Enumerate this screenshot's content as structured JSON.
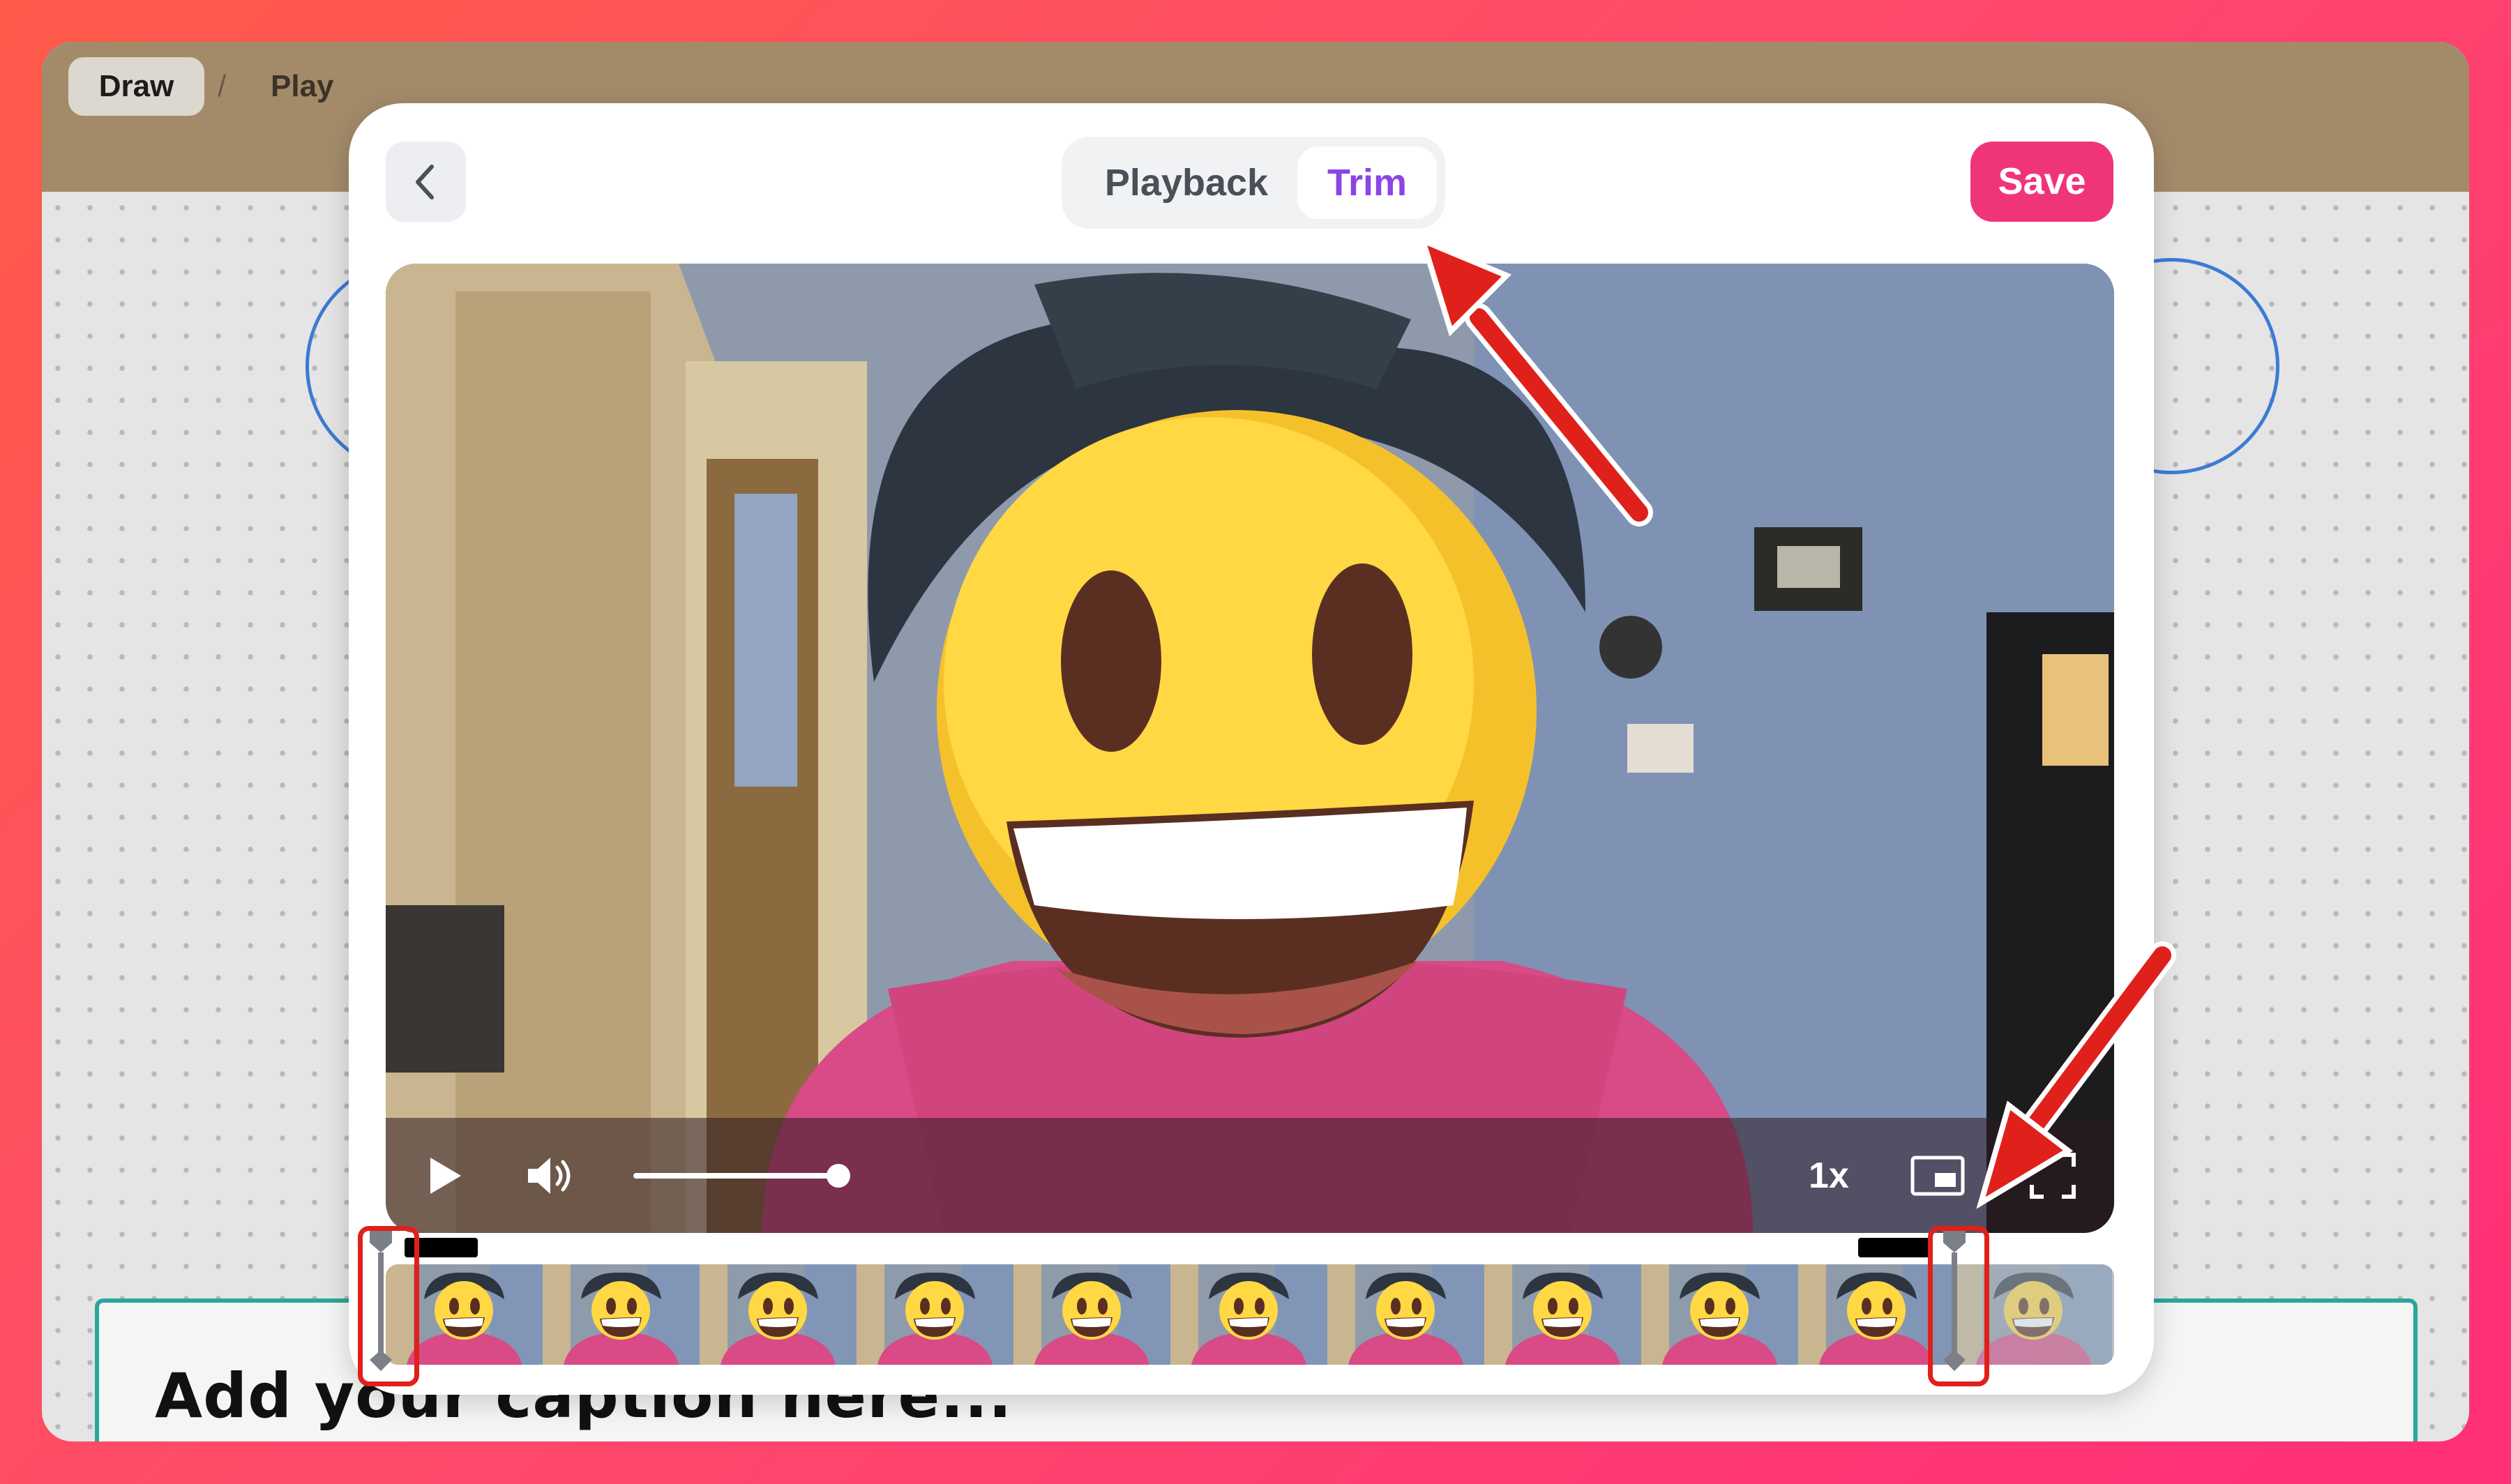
{
  "breadcrumb": {
    "draw_label": "Draw",
    "separator": "/",
    "play_label": "Play"
  },
  "caption_card": {
    "placeholder": "Add your caption here..."
  },
  "modal": {
    "back_icon": "chevron-left-icon",
    "tabs": [
      {
        "label": "Playback",
        "active": false
      },
      {
        "label": "Trim",
        "active": true
      }
    ],
    "save_label": "Save",
    "accent_color": "#8b45e6",
    "save_color": "#f0347a"
  },
  "video_player": {
    "play_icon": "play-icon",
    "volume_icon": "volume-icon",
    "volume_level_percent": 100,
    "speed_label": "1x",
    "pip_icon": "picture-in-picture-icon",
    "fullscreen_icon": "fullscreen-icon"
  },
  "trim_timeline": {
    "thumbnail_count": 11,
    "trim_start_fraction": 0.0,
    "trim_end_fraction": 0.91
  },
  "annotations": {
    "arrow_color": "#e0201b",
    "highlight_color": "#e0201b"
  }
}
